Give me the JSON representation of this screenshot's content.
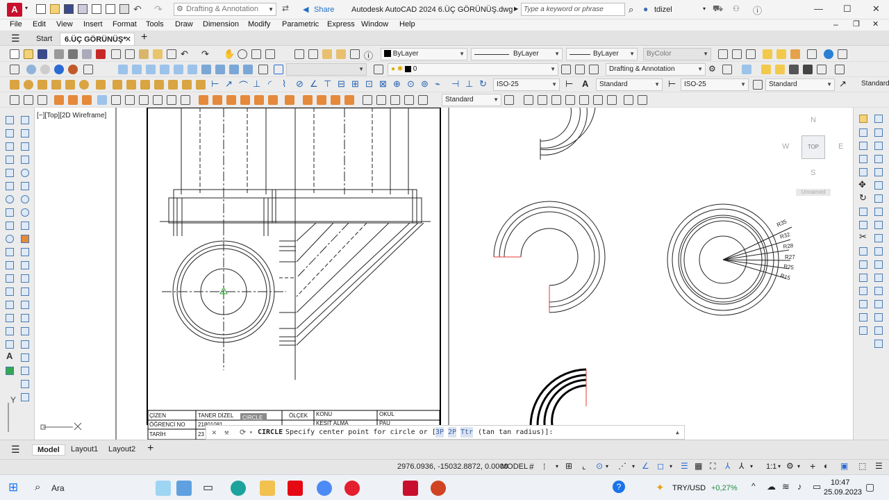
{
  "titlebar": {
    "workspace": "Drafting & Annotation",
    "share": "Share",
    "title": "Autodesk AutoCAD 2024   6.ÜÇ GÖRÜNÜŞ.dwg",
    "search_placeholder": "Type a keyword or phrase",
    "user": "tdizel"
  },
  "menu": [
    "File",
    "Edit",
    "View",
    "Insert",
    "Format",
    "Tools",
    "Draw",
    "Dimension",
    "Modify",
    "Parametric",
    "Express",
    "Window",
    "Help"
  ],
  "file_tabs": {
    "start": "Start",
    "active": "6.ÜÇ GÖRÜNÜŞ*"
  },
  "properties": {
    "color": "ByLayer",
    "linetype": "ByLayer",
    "lineweight": "ByLayer",
    "plotstyle": "ByColor",
    "layer": "0",
    "workspace2": "Drafting & Annotation",
    "dimstyle": "ISO-25",
    "textstyle": "Standard",
    "dimstyle2": "ISO-25",
    "tablestyle": "Standard",
    "mleaderstyle": "Standard",
    "style3": "Standard"
  },
  "viewport": {
    "label": "[−][Top][2D Wireframe]",
    "viewcube": {
      "top": "TOP",
      "n": "N",
      "s": "S",
      "e": "E",
      "w": "W",
      "ucs": "Unnamed"
    }
  },
  "drawing": {
    "radius_labels": [
      "R35",
      "R32",
      "R28",
      "R27",
      "R25",
      "R15"
    ],
    "titleblock": {
      "cizen": "ÇİZEN",
      "cizen_val": "TANER DİZEL",
      "ogrenci": "ÖĞRENCİ NO",
      "ogrenci_val": "21801081",
      "tarih": "TARİH",
      "tarih_val": "23",
      "olcek": "ÖLÇEK",
      "konu": "KONU",
      "konu_val": "KESİT ALMA",
      "okul": "OKUL",
      "okul_val": "PAU",
      "tooltip": "CIRCLE"
    }
  },
  "command": {
    "name": "CIRCLE",
    "prompt": "Specify center point for circle or [",
    "opt1": "3P",
    "opt2": "2P",
    "opt3": "Ttr",
    "tail": "(tan tan radius)]:"
  },
  "layout_tabs": [
    "Model",
    "Layout1",
    "Layout2"
  ],
  "status": {
    "coords": "2976.0936, -15032.8872, 0.0000",
    "mode": "MODEL",
    "scale": "1:1"
  },
  "taskbar": {
    "search": "Ara",
    "currency": "TRY/USD",
    "change": "+0,27%",
    "time": "10:47",
    "date": "25.09.2023"
  },
  "colors": {
    "accent_red": "#c8102e",
    "ucs_green": "#22aa22",
    "highlight_red": "#e53935"
  }
}
